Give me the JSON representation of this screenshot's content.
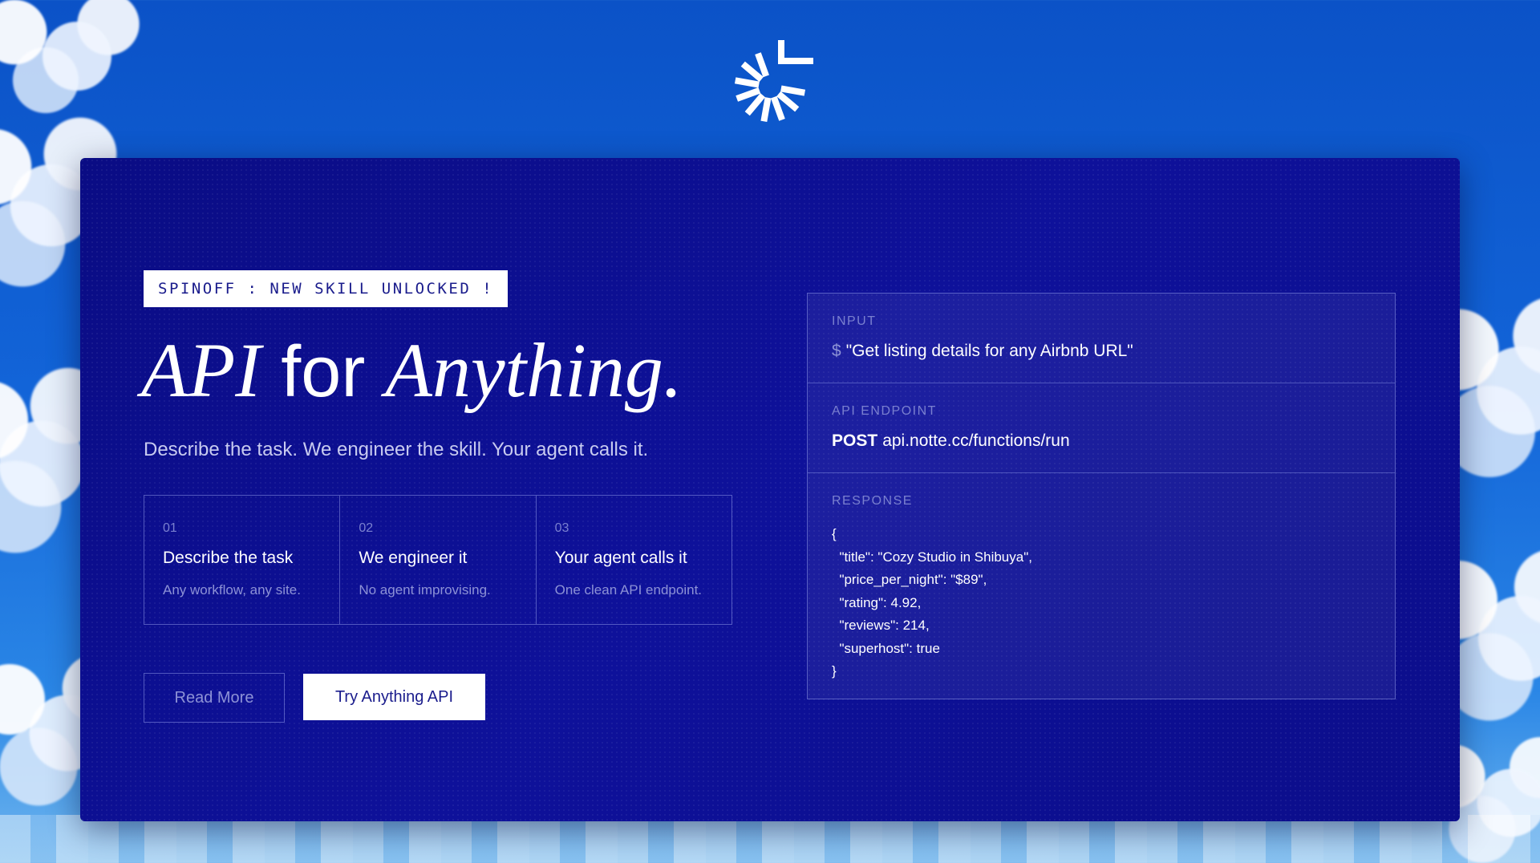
{
  "badge": "SPINOFF : NEW SKILL UNLOCKED !",
  "headline": {
    "part1": "API",
    "part2": " for ",
    "part3": "Anything."
  },
  "subtitle": "Describe the task. We engineer the skill. Your agent calls it.",
  "steps": [
    {
      "num": "01",
      "title": "Describe the task",
      "desc": "Any workflow, any site."
    },
    {
      "num": "02",
      "title": "We engineer it",
      "desc": "No agent improvising."
    },
    {
      "num": "03",
      "title": "Your agent calls it",
      "desc": "One clean API endpoint."
    }
  ],
  "buttons": {
    "read_more": "Read More",
    "try": "Try Anything API"
  },
  "panel": {
    "input": {
      "label": "INPUT",
      "prompt": "$",
      "value": "\"Get listing details for any Airbnb URL\""
    },
    "endpoint": {
      "label": "API ENDPOINT",
      "method": "POST",
      "url": "api.notte.cc/functions/run"
    },
    "response": {
      "label": "RESPONSE",
      "body": "{\n  \"title\": \"Cozy Studio in Shibuya\",\n  \"price_per_night\": \"$89\",\n  \"rating\": 4.92,\n  \"reviews\": 214,\n  \"superhost\": true\n}"
    }
  },
  "colors": {
    "card_bg": "#0c0e8f",
    "sky": "#0b52c7",
    "accent_text": "#1a1c8c"
  },
  "icons": {
    "logo": "burst-logo-icon"
  }
}
